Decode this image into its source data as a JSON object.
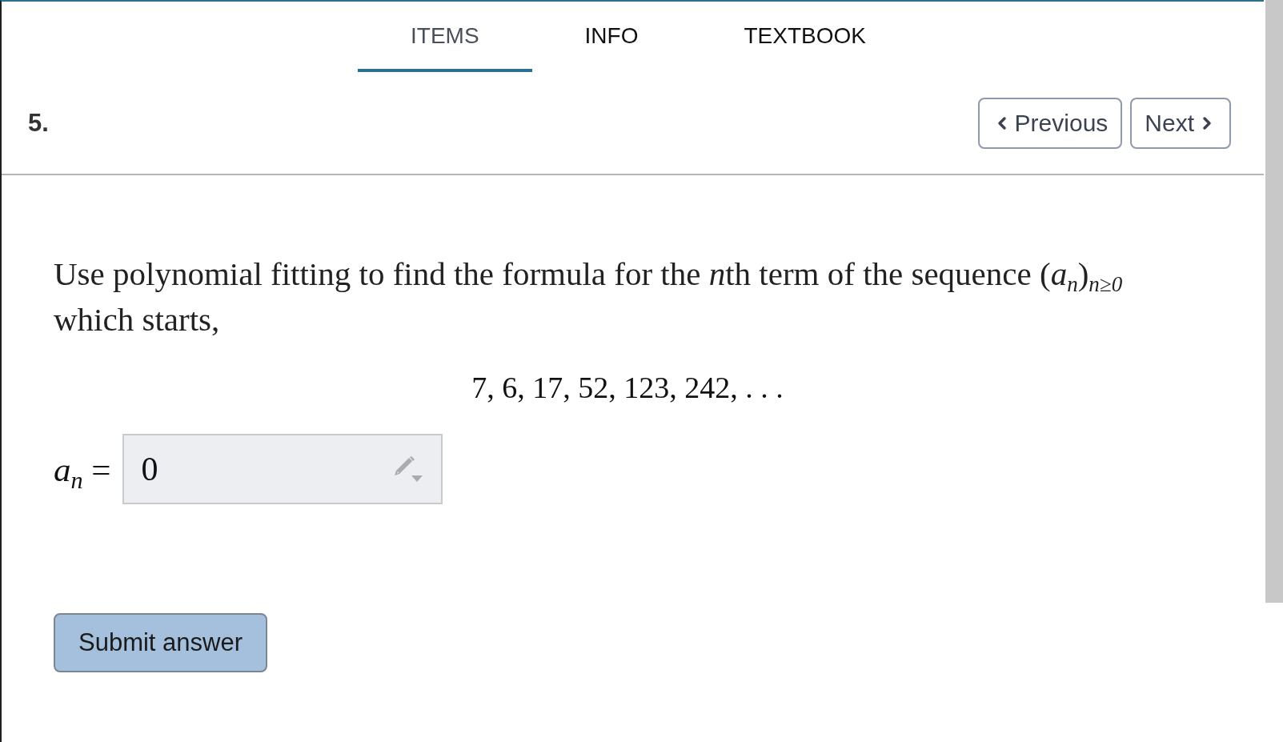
{
  "tabs": [
    {
      "label": "ITEMS",
      "selected": true
    },
    {
      "label": "INFO",
      "selected": false
    },
    {
      "label": "TEXTBOOK",
      "selected": false
    }
  ],
  "question": {
    "number": "5.",
    "nav": [
      {
        "kind": "previous",
        "label": "Previous"
      },
      {
        "kind": "next",
        "label": "Next"
      }
    ],
    "text": [
      {
        "kind": "text",
        "text": "Use polynomial fitting to find the formula for the "
      },
      {
        "kind": "math",
        "text": "n"
      },
      {
        "kind": "text",
        "text": "th term of the sequence (*a*$_{n}$)$_{n≥0}$ which starts,"
      }
    ],
    "sequence": "7, 6, 17, 52, 123, 242, . . .",
    "answer": {
      "label": "*a*$_{n}$ =",
      "value": "0"
    },
    "submit": "Submit answer"
  }
}
